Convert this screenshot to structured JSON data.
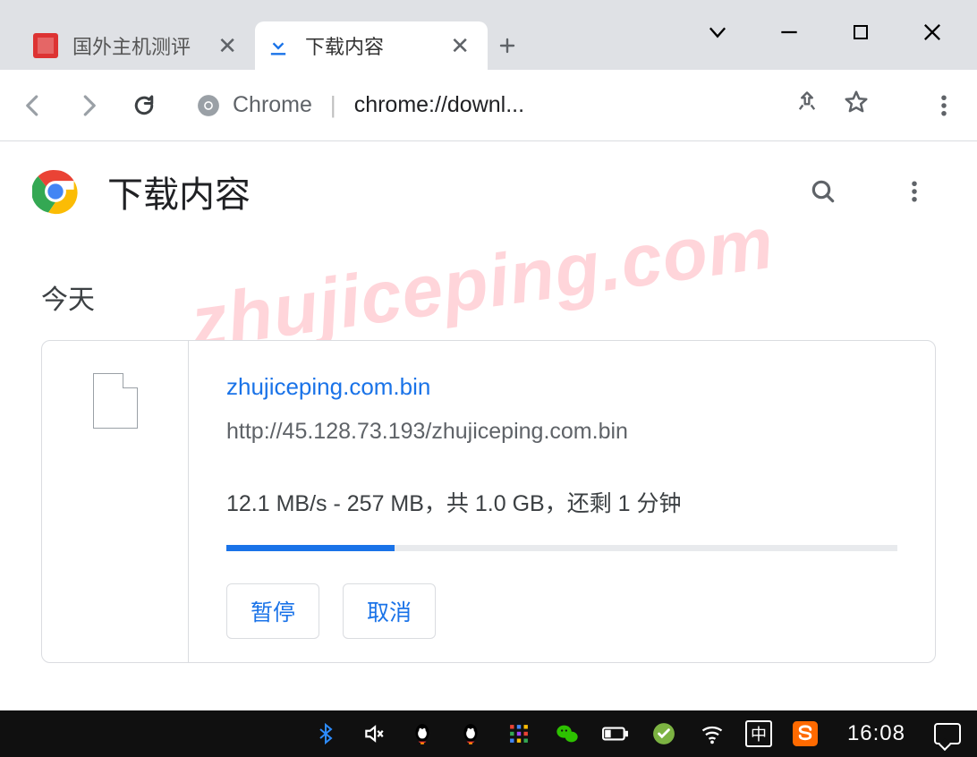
{
  "tabs": [
    {
      "title": "国外主机测评",
      "active": false
    },
    {
      "title": "下载内容",
      "active": true
    }
  ],
  "omnibox": {
    "label": "Chrome",
    "url": "chrome://downl..."
  },
  "page": {
    "title": "下载内容"
  },
  "section_today": "今天",
  "download": {
    "filename": "zhujiceping.com.bin",
    "url": "http://45.128.73.193/zhujiceping.com.bin",
    "status": "12.1 MB/s - 257 MB，共 1.0 GB，还剩 1 分钟",
    "progress_percent": 25,
    "pause_label": "暂停",
    "cancel_label": "取消"
  },
  "watermark": "zhujiceping.com",
  "taskbar": {
    "ime": "中",
    "clock": "16:08"
  }
}
